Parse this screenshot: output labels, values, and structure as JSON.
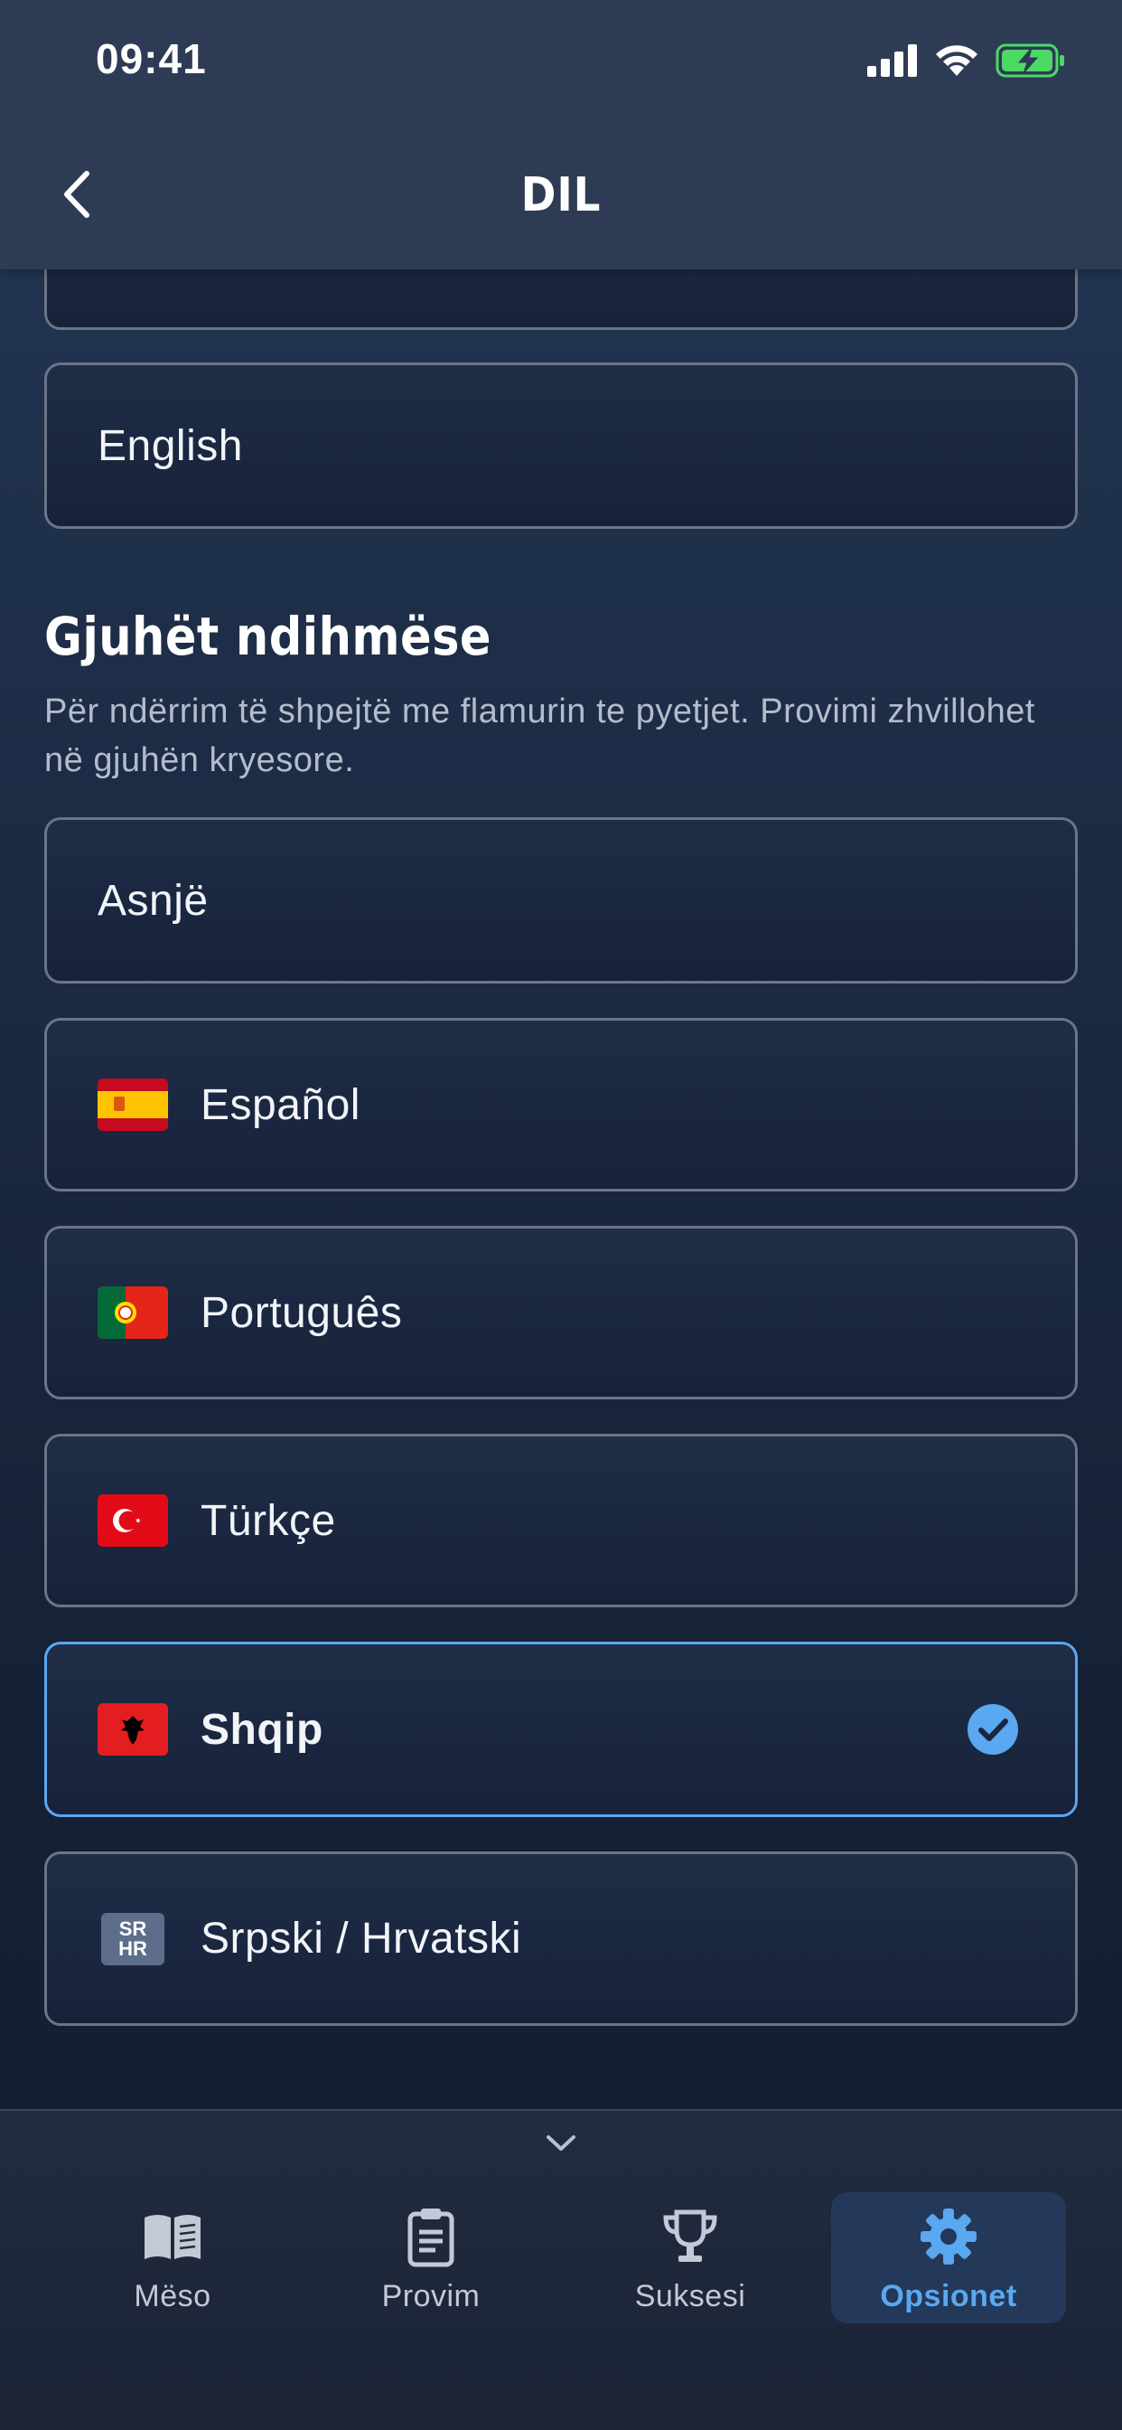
{
  "status_bar": {
    "time": "09:41"
  },
  "header": {
    "title": "DIL"
  },
  "primary_language": {
    "label": "English"
  },
  "auxiliary": {
    "title": "Gjuhët ndihmëse",
    "description": "Për ndërrim të shpejtë me flamurin te pyetjet. Provimi zhvillohet në gjuhën kryesore.",
    "options": [
      {
        "label": "Asnjë",
        "flag": "none"
      },
      {
        "label": "Español",
        "flag": "spain-flag"
      },
      {
        "label": "Português",
        "flag": "portugal-flag"
      },
      {
        "label": "Türkçe",
        "flag": "turkey-flag"
      },
      {
        "label": "Shqip",
        "flag": "albania-flag",
        "selected": true
      },
      {
        "label": "Srpski / Hrvatski",
        "flag": "sr-hr-badge"
      }
    ],
    "sr_badge": {
      "line1": "SR",
      "line2": "HR"
    }
  },
  "tabbar": {
    "tabs": [
      {
        "label": "Mëso",
        "icon": "book-icon"
      },
      {
        "label": "Provim",
        "icon": "clipboard-icon"
      },
      {
        "label": "Suksesi",
        "icon": "trophy-icon"
      },
      {
        "label": "Opsionet",
        "icon": "gear-icon",
        "active": true
      }
    ]
  },
  "colors": {
    "accent": "#5aa8f0",
    "header_bg": "#2e3b55",
    "card_border": "#6b7588"
  }
}
